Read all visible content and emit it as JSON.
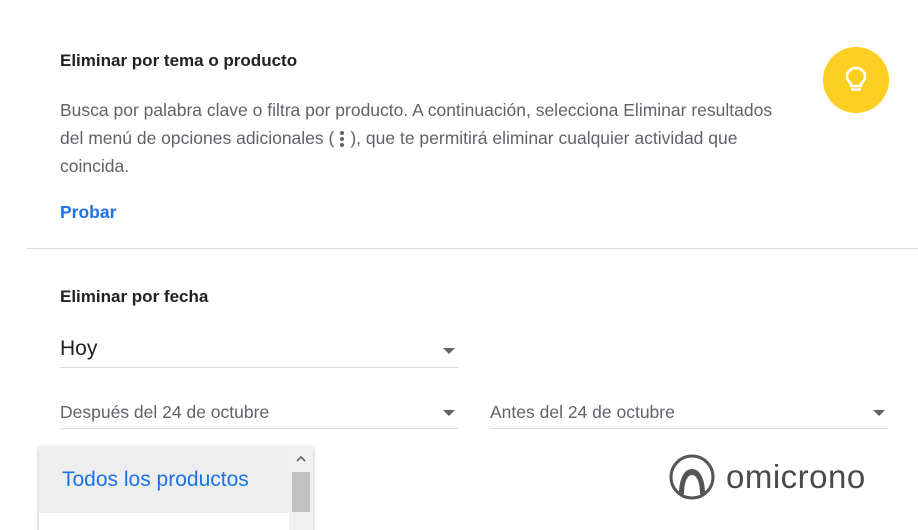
{
  "topic_section": {
    "title": "Eliminar por tema o producto",
    "desc_part1": "Busca por palabra clave o filtra por producto. A continuación, selecciona Eliminar resultados del menú de opciones adicionales (",
    "desc_part2": "), que te permitirá eliminar cualquier actividad que coincida.",
    "link_label": "Probar",
    "icon": "lightbulb-icon",
    "icon_bg": "#fbd023"
  },
  "date_section": {
    "title": "Eliminar por fecha",
    "range_value": "Hoy",
    "after_value": "Después del 24 de octubre",
    "before_value": "Antes del 24 de octubre"
  },
  "product_dropdown": {
    "option": "Todos los productos"
  },
  "watermark": {
    "text": "omicrono"
  },
  "colors": {
    "accent": "#1a73e8",
    "text_secondary": "#5f6368"
  }
}
